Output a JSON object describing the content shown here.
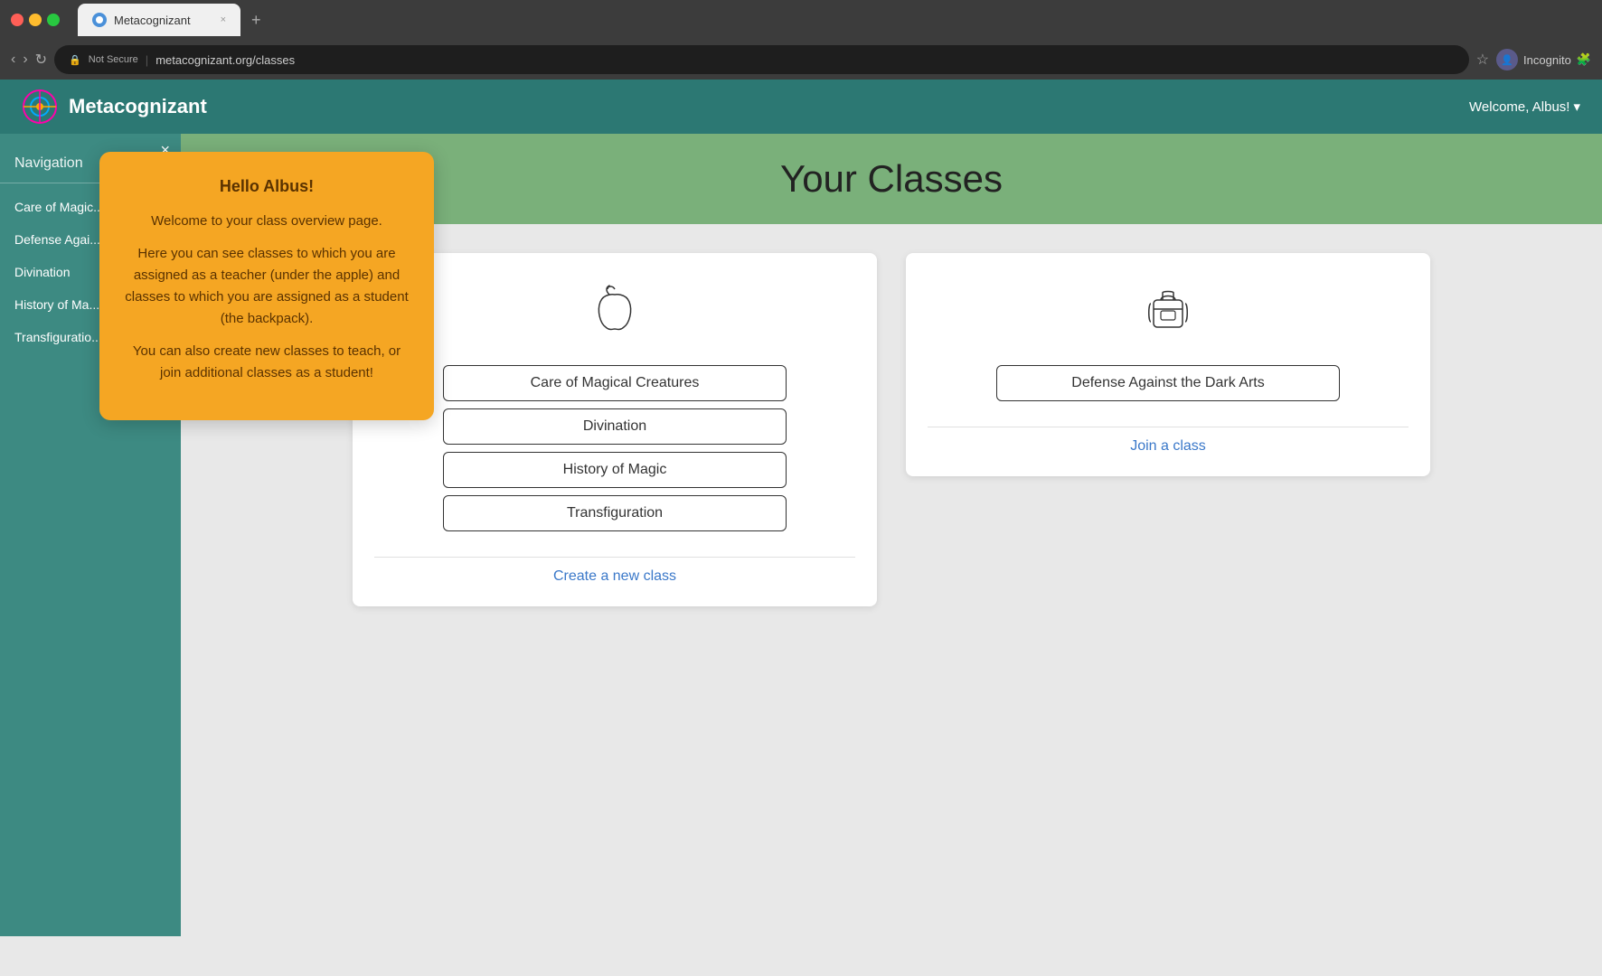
{
  "browser": {
    "traffic_lights": [
      "red",
      "yellow",
      "green"
    ],
    "tab_title": "Metacognizant",
    "tab_close": "×",
    "tab_new": "+",
    "nav": {
      "back": "‹",
      "forward": "›",
      "reload": "↻"
    },
    "url": {
      "lock": "🔒",
      "not_secure": "Not Secure",
      "separator": "|",
      "address": "metacognizant.org/classes"
    },
    "star": "☆",
    "profile": {
      "label": "Incognito",
      "icon": "👤"
    }
  },
  "app": {
    "title": "Metacognizant",
    "welcome": "Welcome, Albus!",
    "welcome_caret": "▾"
  },
  "sidebar": {
    "nav_label": "Navigation",
    "close_x": "×",
    "items": [
      "Care of Magic...",
      "Defense Agai...",
      "Divination",
      "History of Ma...",
      "Transfiguratio..."
    ]
  },
  "main": {
    "hero_title": "Your Classes",
    "teacher_card": {
      "icon_label": "apple-icon",
      "classes": [
        "Care of Magical Creatures",
        "Divination",
        "History of Magic",
        "Transfiguration"
      ],
      "action": "Create a new class"
    },
    "student_card": {
      "icon_label": "backpack-icon",
      "classes": [
        "Defense Against the Dark Arts"
      ],
      "action": "Join a class"
    }
  },
  "tooltip": {
    "title": "Hello Albus!",
    "paragraph1": "Welcome to your class overview page.",
    "paragraph2": "Here you can see classes to which you are assigned as a teacher (under the apple) and classes to which you are assigned as a student (the backpack).",
    "paragraph3": "You can also create new classes to teach, or join additional classes as a student!"
  }
}
